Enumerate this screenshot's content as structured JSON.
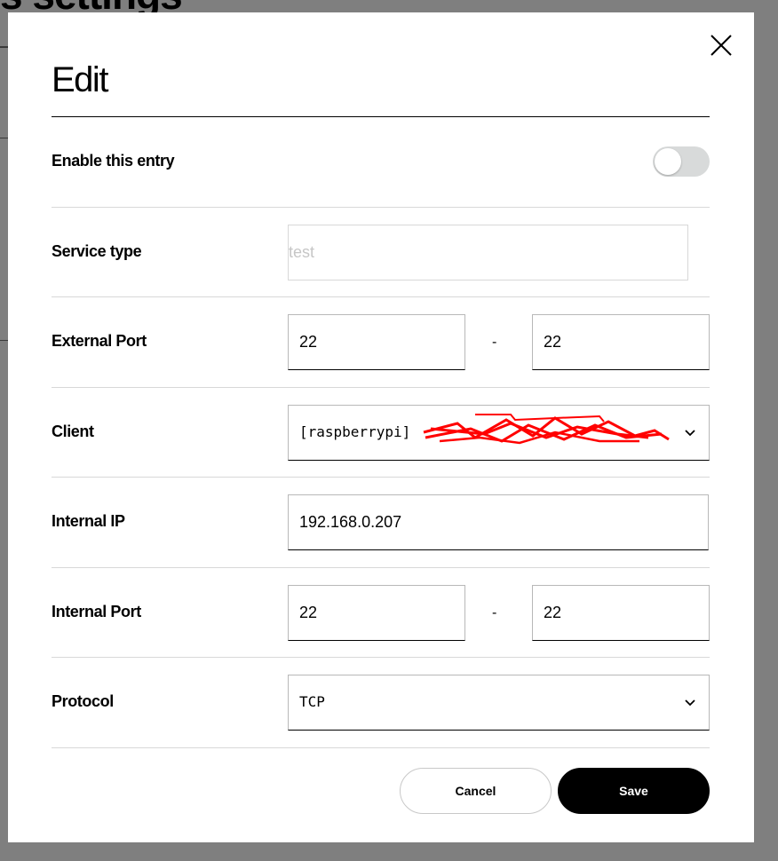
{
  "background_page": {
    "title_fragment": "s settings"
  },
  "modal": {
    "title": "Edit",
    "close_icon": "close-icon",
    "enable": {
      "label": "Enable this entry",
      "enabled": false
    },
    "service_type": {
      "label": "Service type",
      "value": "",
      "placeholder": "test"
    },
    "external_port": {
      "label": "External Port",
      "start": "22",
      "separator": "-",
      "end": "22"
    },
    "client": {
      "label": "Client",
      "selected": "[raspberrypi]",
      "icon": "chevron-down-icon"
    },
    "internal_ip": {
      "label": "Internal IP",
      "value": "192.168.0.207"
    },
    "internal_port": {
      "label": "Internal Port",
      "start": "22",
      "separator": "-",
      "end": "22"
    },
    "protocol": {
      "label": "Protocol",
      "selected": "TCP",
      "icon": "chevron-down-icon"
    },
    "buttons": {
      "cancel": "Cancel",
      "save": "Save"
    }
  },
  "colors": {
    "overlay": "#7f7f7f",
    "primary": "#000000",
    "toggle_off": "#d8dada",
    "divider": "#d8d8d8"
  }
}
